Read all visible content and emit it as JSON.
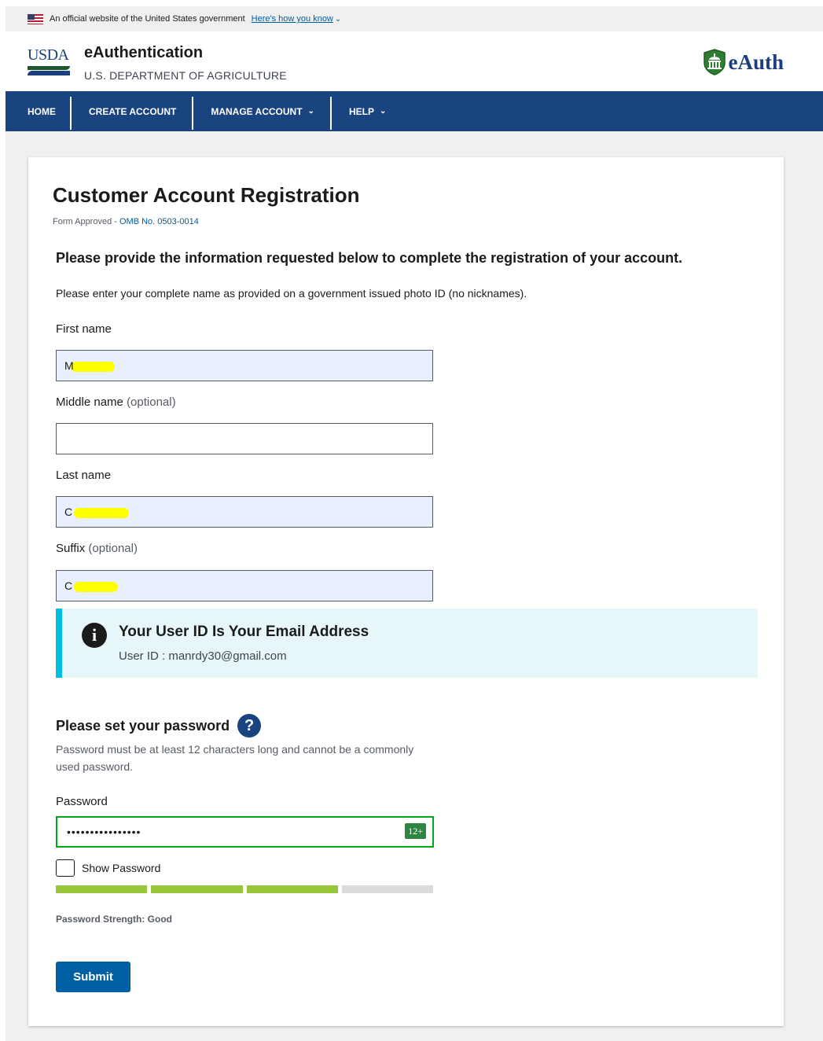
{
  "gov_banner": {
    "text": "An official website of the United States government",
    "link": "Here's how you know"
  },
  "header": {
    "logo_text": "USDA",
    "title": "eAuthentication",
    "subtitle": "U.S. DEPARTMENT OF AGRICULTURE",
    "brand_text": "eAuth"
  },
  "nav": {
    "items": [
      {
        "label": "HOME"
      },
      {
        "label": "CREATE ACCOUNT"
      },
      {
        "label": "MANAGE ACCOUNT"
      },
      {
        "label": "HELP"
      }
    ]
  },
  "form": {
    "title": "Customer Account Registration",
    "form_approved": "Form Approved - ",
    "omb": "OMB No. 0503-0014",
    "intro": "Please provide the information requested below to complete the registration of your account.",
    "instruction": "Please enter your complete name as provided on a government issued photo ID (no nicknames).",
    "first_name": {
      "label": "First name",
      "value": "M"
    },
    "middle_name": {
      "label": "Middle name",
      "optional": "(optional)",
      "value": ""
    },
    "last_name": {
      "label": "Last name",
      "value": "C"
    },
    "suffix": {
      "label": "Suffix",
      "optional": "(optional)",
      "value": "C"
    }
  },
  "alert": {
    "icon": "info-icon",
    "title": "Your User ID Is Your Email Address",
    "body": "User ID : manrdy30@gmail.com"
  },
  "password": {
    "heading": "Please set your password",
    "help_icon": "question-icon",
    "hint": "Password must be at least 12 characters long and cannot be a commonly used password.",
    "label": "Password",
    "value": "••••••••••••••••",
    "badge": "12+",
    "show_label": "Show Password",
    "show_checked": false,
    "strength_segments_filled": 3,
    "strength_segments_total": 4,
    "strength_label": "Password Strength: Good"
  },
  "submit_label": "Submit",
  "colors": {
    "nav_bg": "#1a4480",
    "accent": "#005ea2",
    "alert_border": "#00bde3",
    "strength_filled": "#98c73c",
    "strength_empty": "#dcdcdc",
    "password_border": "#00a91c",
    "autofill_bg": "#e8f0fe"
  }
}
